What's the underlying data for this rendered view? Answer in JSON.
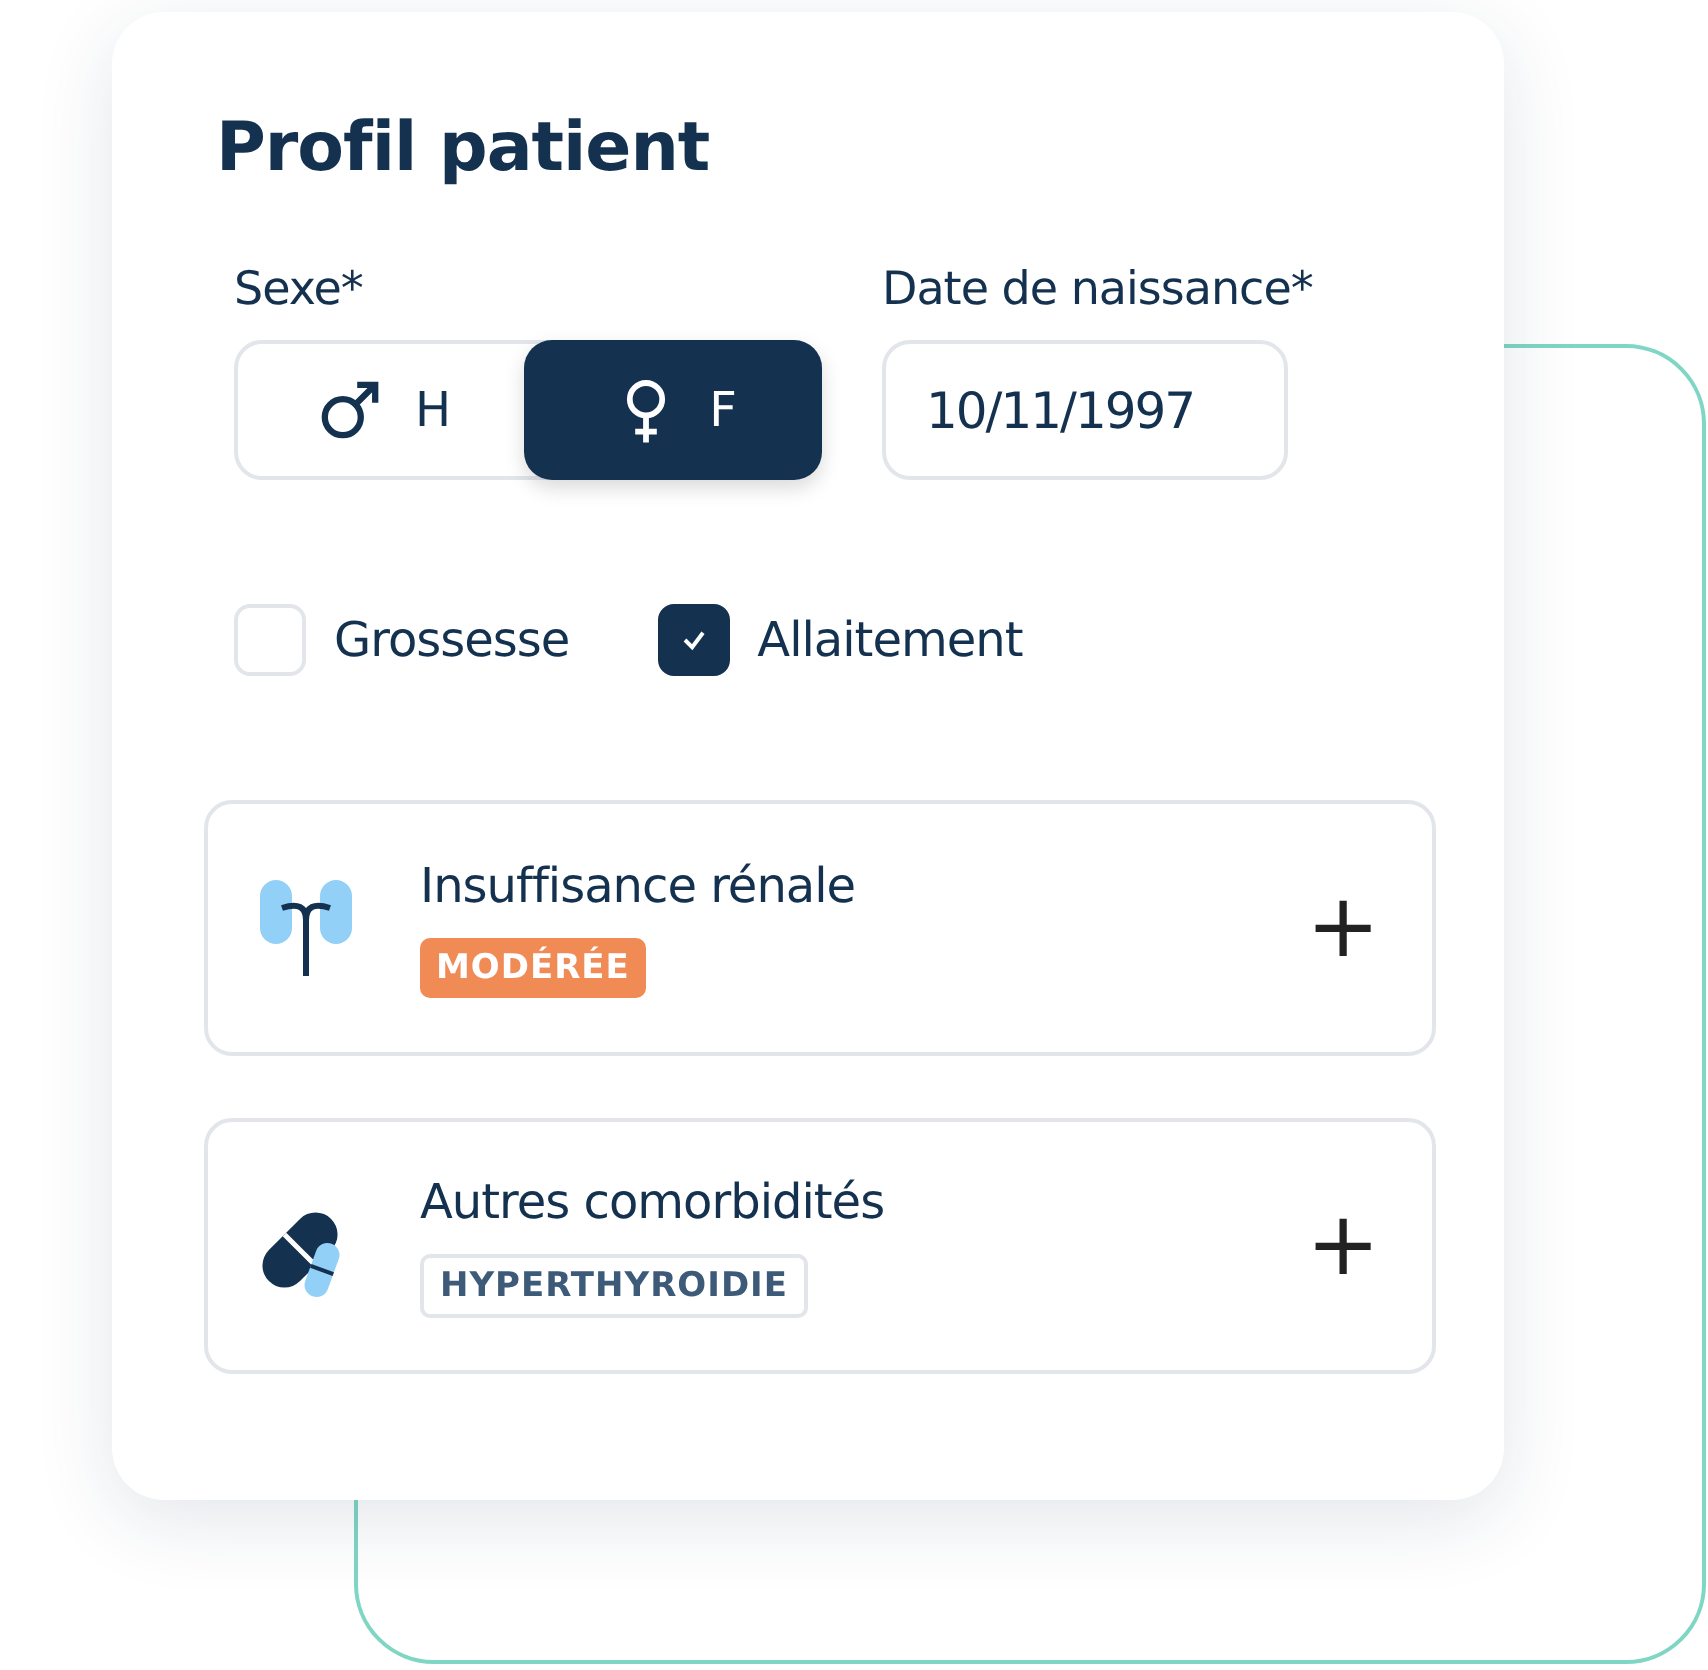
{
  "title": "Profil patient",
  "sex": {
    "label": "Sexe*",
    "options": [
      {
        "kind": "male",
        "label": "H",
        "selected": false
      },
      {
        "kind": "female",
        "label": "F",
        "selected": true
      }
    ]
  },
  "birth_date": {
    "label": "Date de naissance*",
    "value": "10/11/1997"
  },
  "checkboxes": [
    {
      "label": "Grossesse",
      "checked": false
    },
    {
      "label": "Allaitement",
      "checked": true
    }
  ],
  "conditions": [
    {
      "kind": "kidney",
      "title": "Insuffisance rénale",
      "tag": {
        "kind": "filled",
        "text": "MODÉRÉE"
      },
      "action": "+"
    },
    {
      "kind": "pills",
      "title": "Autres comorbidités",
      "tag": {
        "kind": "outline",
        "text": "HYPERTHYROIDIE"
      },
      "action": "+"
    }
  ]
}
